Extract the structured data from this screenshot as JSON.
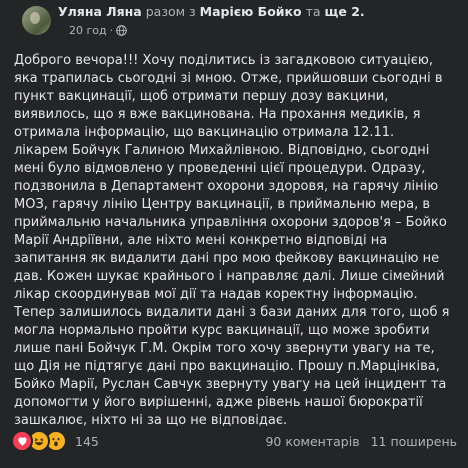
{
  "post": {
    "author": "Уляна Ляна",
    "with_word": "разом з",
    "tagged": "Марією Бойко",
    "and_word": "та",
    "others": "ще 2.",
    "timestamp": "20 год",
    "separator": "·",
    "privacy_icon": "globe-icon",
    "body": "Доброго вечора!!! Хочу поділитись із загадковою ситуацією, яка трапилась сьогодні зі мною. Отже, прийшовши сьогодні в пункт вакцинації, щоб отримати першу дозу вакцини, виявилось, що я вже вакцинована. На прохання медиків, я отримала інформацію, що вакцинацію отримала 12.11. лікарем Бойчук Галиною Михайлівною. Відповідно, сьогодні мені було відмовлено у проведенні цієї процедури. Одразу, подзвонила в Департамент охорони здоровя, на гарячу лінію МОЗ, гарячу лінію Центру вакцинації, в приймальню мера, в приймальню начальника управління охорони здоров'я – Бойко Марії Андріївни, але ніхто мені конкретно відповіді на запитання як видалити дані про мою фейкову вакцинацію не дав. Кожен шукає крайнього і направляє далі. Лише сімейний лікар скоординував мої дії та надав коректну інформацію. Тепер залишилось видалити дані з бази даних для того, щоб я могла нормально пройти курс вакцинації, що може зробити лише пані Бойчук Г.М.  Окрім того хочу звернути увагу на те, що Дія не підтягує дані про вакцинацію. Прошу п.Марцінківа, Бойко Марії, Руслан Савчук звернуту увагу на цей інцидент та допомогти у його вирішенні, адже рівень нашої бюрократії зашкалює, ніхто ні за що не відповідає."
  },
  "footer": {
    "reaction_icons": [
      "heart-icon",
      "haha-icon",
      "wow-icon"
    ],
    "reaction_count": "145",
    "comments": "90 коментарів",
    "shares": "11 поширень"
  },
  "colors": {
    "background": "#242526",
    "text_primary": "#e4e6eb",
    "text_secondary": "#b0b3b8",
    "heart": "#f33e58",
    "haha": "#f7b125"
  }
}
